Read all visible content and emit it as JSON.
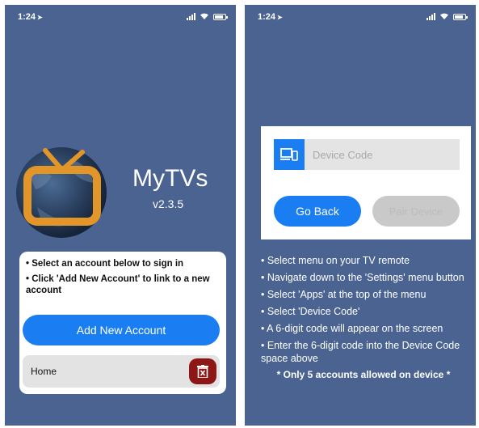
{
  "colors": {
    "background": "#4a6391",
    "primary": "#1a7ef2",
    "danger": "#8d1717",
    "logo_orange": "#e2962a",
    "disabled": "#c9c9c9"
  },
  "left_screen": {
    "status": {
      "time": "1:24",
      "location_glyph": "➤"
    },
    "app": {
      "title": "MyTVs",
      "version": "v2.3.5"
    },
    "card": {
      "bullets": [
        "• Select an account below to sign in",
        "• Click 'Add New Account' to link to a new account"
      ],
      "add_button_label": "Add New Account",
      "accounts": [
        {
          "name": "Home"
        }
      ]
    }
  },
  "right_screen": {
    "status": {
      "time": "1:24",
      "location_glyph": "➤"
    },
    "device_code": {
      "placeholder": "Device Code",
      "value": ""
    },
    "buttons": {
      "go_back": "Go Back",
      "pair_device": "Pair Device"
    },
    "instructions": [
      "• Select menu on your TV remote",
      "• Navigate down to the 'Settings' menu button",
      "• Select 'Apps' at the top of the menu",
      "• Select 'Device Code'",
      "• A 6-digit code will appear on the screen",
      "• Enter the 6-digit code into the Device Code space above"
    ],
    "footnote": "* Only 5 accounts allowed on device *"
  }
}
